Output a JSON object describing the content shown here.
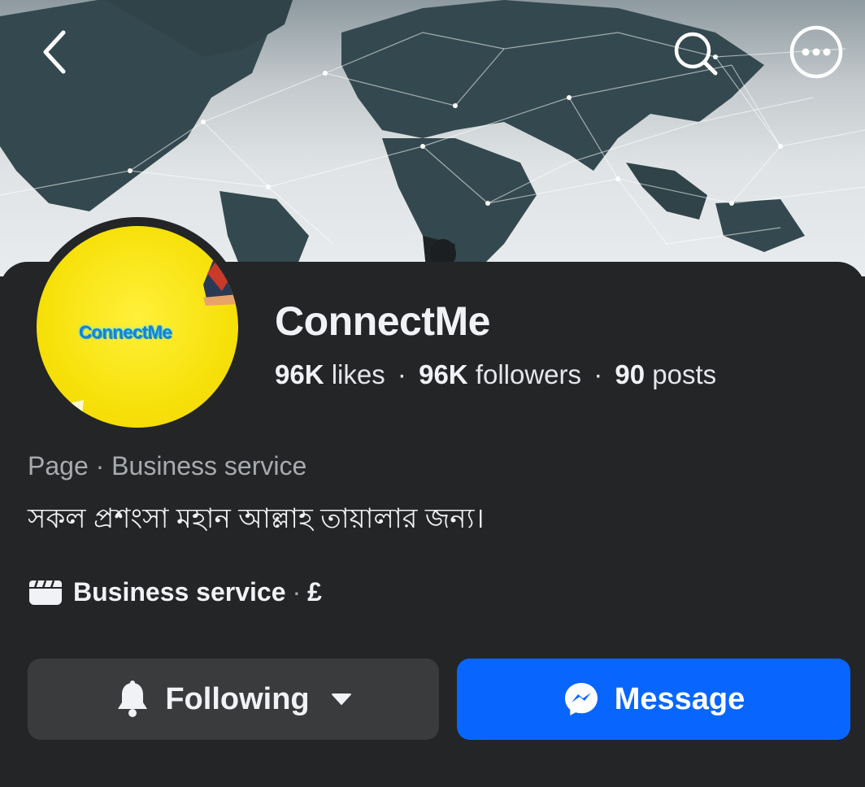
{
  "header": {
    "back_icon": "chevron-left-icon",
    "search_icon": "search-icon",
    "more_icon": "more-options-icon"
  },
  "profile": {
    "avatar_text": "ConnectMe",
    "name": "ConnectMe",
    "stats": {
      "likes_value": "96K",
      "likes_label": "likes",
      "followers_value": "96K",
      "followers_label": "followers",
      "posts_value": "90",
      "posts_label": "posts",
      "separator": "·"
    },
    "category_line": "Page · Business service",
    "bio": "সকল প্রশংসা মহান আল্লাহ তায়ালার জন্য।",
    "info": {
      "icon": "clapperboard-icon",
      "label": "Business service",
      "separator": "·",
      "price": "£"
    }
  },
  "actions": {
    "following_label": "Following",
    "message_label": "Message"
  },
  "colors": {
    "background": "#242526",
    "button_secondary": "#3a3b3c",
    "button_primary": "#0866ff",
    "avatar_yellow": "#f7e10b"
  }
}
